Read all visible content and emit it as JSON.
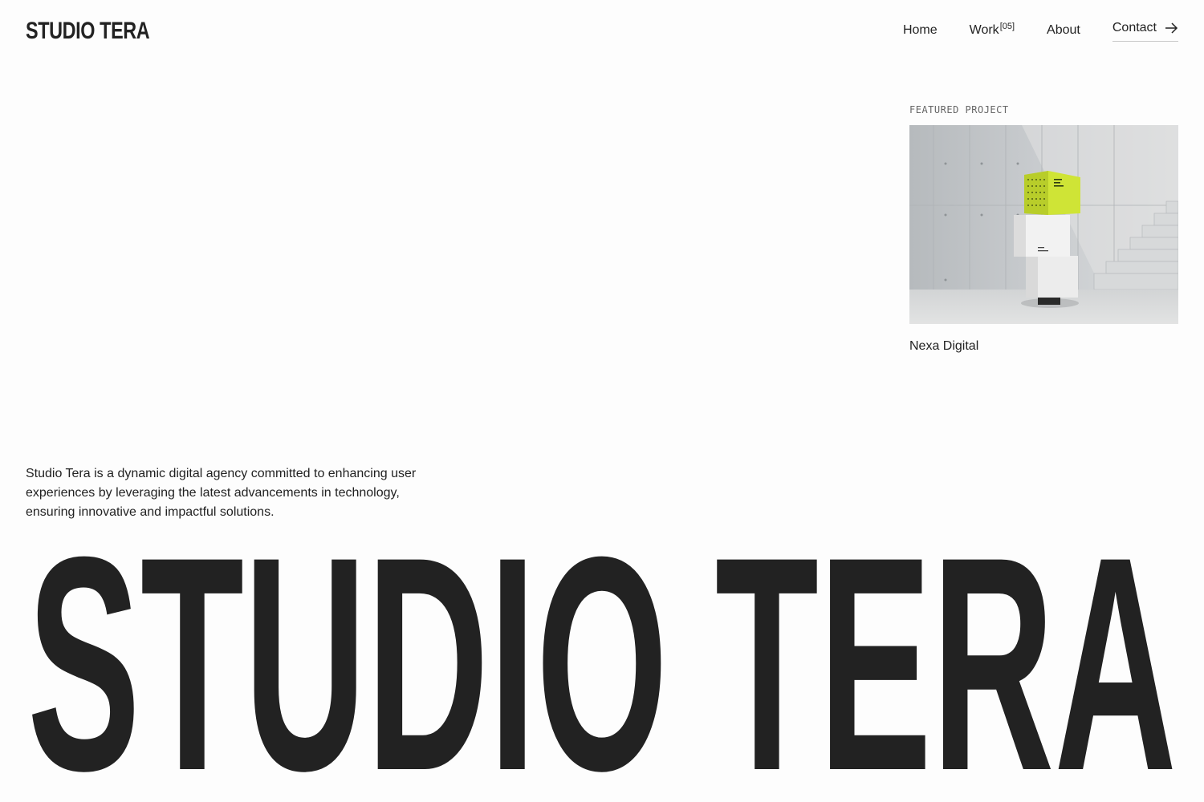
{
  "header": {
    "logo": "STUDIO TERA",
    "nav": {
      "home": "Home",
      "work": "Work",
      "work_count": "[05]",
      "about": "About",
      "contact": "Contact"
    }
  },
  "featured": {
    "label": "FEATURED PROJECT",
    "title": "Nexa Digital",
    "image_icon": "product-packaging-photo",
    "accent_color": "#cfe436"
  },
  "intro": {
    "text": "Studio Tera is a dynamic digital agency committed to enhancing user experiences by leveraging the latest advancements in technology, ensuring innovative and impactful solutions."
  },
  "hero": {
    "title": "STUDIO TERA"
  },
  "colors": {
    "background": "#fdfdfd",
    "text": "#222222"
  }
}
